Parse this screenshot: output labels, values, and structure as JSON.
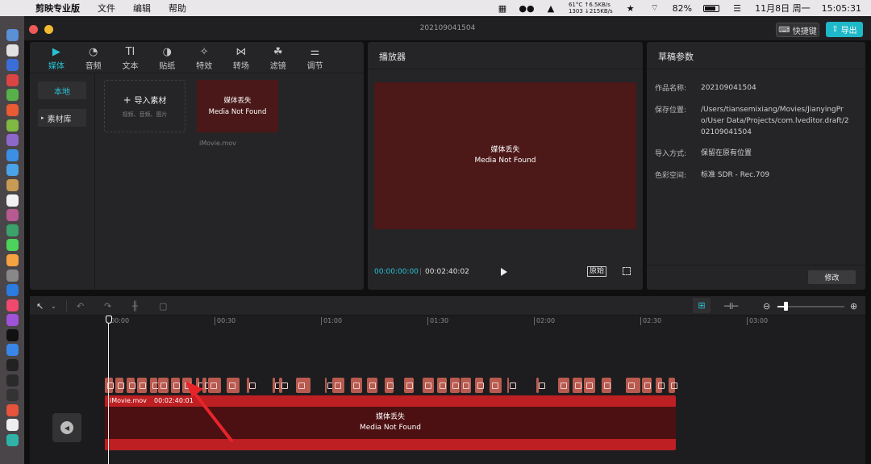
{
  "menubar": {
    "app_name": "剪映专业版",
    "menus": [
      "文件",
      "编辑",
      "帮助"
    ],
    "net_line1": "61°C ↑6.5KB/s",
    "net_line2": "1303 ↓215KB/s",
    "battery": "82%",
    "date": "11月8日 周一",
    "time": "15:05:31"
  },
  "window": {
    "title": "202109041504",
    "shortcut_label": "快捷键",
    "export_label": "导出"
  },
  "media_panel": {
    "tabs": [
      {
        "label": "媒体",
        "icon": "media-icon"
      },
      {
        "label": "音频",
        "icon": "audio-icon"
      },
      {
        "label": "文本",
        "icon": "text-icon"
      },
      {
        "label": "贴纸",
        "icon": "sticker-icon"
      },
      {
        "label": "特效",
        "icon": "effects-icon"
      },
      {
        "label": "转场",
        "icon": "transition-icon"
      },
      {
        "label": "滤镜",
        "icon": "filter-icon"
      },
      {
        "label": "调节",
        "icon": "adjust-icon"
      }
    ],
    "sidebar_local": "本地",
    "sidebar_library": "素材库",
    "import_label": "导入素材",
    "import_hint": "视频、音频、图片",
    "missing_cn": "媒体丢失",
    "missing_en": "Media Not Found",
    "file_name": "iMovie.mov"
  },
  "player": {
    "title": "播放器",
    "missing_cn": "媒体丢失",
    "missing_en": "Media Not Found",
    "current_time": "00:00:00:00",
    "total_time": "00:02:40:02",
    "original_label": "原始"
  },
  "draft": {
    "title": "草稿参数",
    "fields": [
      {
        "key": "作品名称:",
        "value": "202109041504"
      },
      {
        "key": "保存位置:",
        "value": "/Users/tiansemixiang/Movies/JianyingPro/User Data/Projects/com.lveditor.draft/202109041504"
      },
      {
        "key": "导入方式:",
        "value": "保留在原有位置"
      },
      {
        "key": "色彩空间:",
        "value": "标准 SDR - Rec.709"
      }
    ],
    "edit_label": "修改"
  },
  "timeline": {
    "ruler_labels": [
      "00:00",
      "00:30",
      "01:00",
      "01:30",
      "02:00",
      "02:30",
      "03:00"
    ],
    "clip_name": "iMovie.mov",
    "clip_duration": "00:02:40:01",
    "missing_cn": "媒体丢失",
    "missing_en": "Media Not Found",
    "zoom_level": 0.12
  },
  "colors": {
    "accent": "#27c3d3",
    "clip_red": "#bd1f22",
    "annotation_arrow": "#e8242b"
  }
}
